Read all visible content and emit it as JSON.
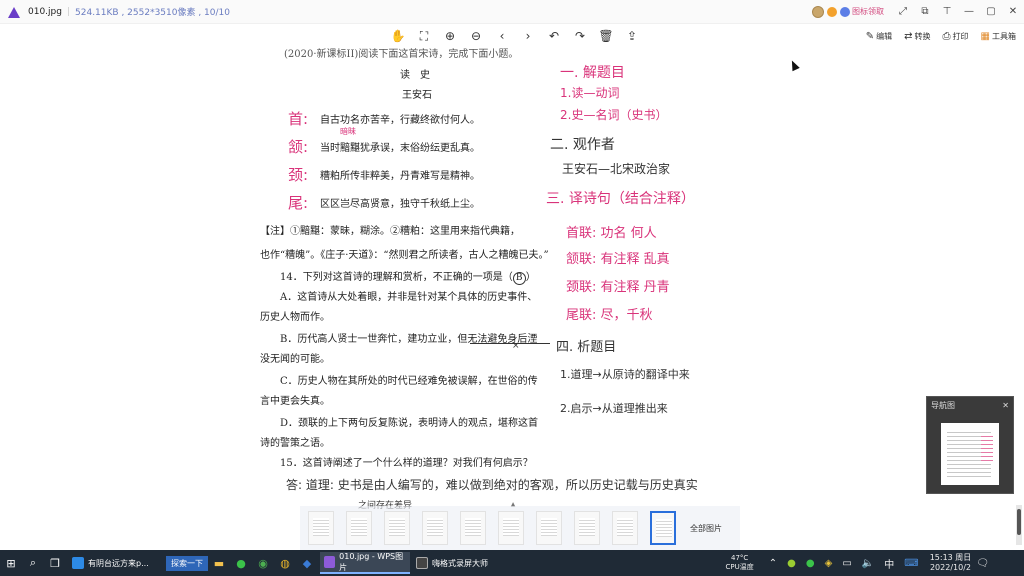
{
  "titlebar": {
    "filename": "010.jpg",
    "fileinfo": "524.11KB , 2552*3510像素 , 10/10",
    "vip_label": "图标领取"
  },
  "toolbar": {
    "right_buttons": [
      "编辑",
      "转换",
      "打印",
      "工具箱"
    ]
  },
  "doc": {
    "intro": "(2020·新课标II)阅读下面这首宋诗，完成下面小题。",
    "title": "读　史",
    "author": "王安石",
    "poem": [
      "自古功名亦苦辛，行藏终欲付何人。",
      "当时黯黮犹承误，末俗纷纭更乱真。",
      "糟粕所传非粹美，丹青难写是精神。",
      "区区岂尽高贤意，独守千秋纸上尘。"
    ],
    "note1": "【注】①黯黮：蒙昧，糊涂。②糟粕：这里用来指代典籍，",
    "note2": "也作“糟魄”。《庄子·天道》：“然则君之所读者，古人之糟魄已夫。”",
    "q14": "14．下列对这首诗的理解和赏析，不正确的一项是（",
    "q14_answer": "B",
    "q14_close": "）",
    "optA1": "A．这首诗从大处着眼，并非是针对某个具体的历史事件、",
    "optA2": "历史人物而作。",
    "optB1": "B．历代高人贤士一世奔忙，建功立业，但无法避免身后湮",
    "optB2": "没无闻的可能。",
    "optC1": "C．历史人物在其所处的时代已经难免被误解，在世俗的传",
    "optC2": "言中更会失真。",
    "optD1": "D．颈联的上下两句反复陈说，表明诗人的观点，堪称这首",
    "optD2": "诗的警策之语。",
    "q15": "15．这首诗阐述了一个什么样的道理？对我们有何启示？",
    "hw_left": [
      "首:",
      "颔:",
      "颈:",
      "尾:"
    ],
    "hw_above": "暗昧",
    "hw_x": "×",
    "hw_right": [
      "一. 解题目",
      "1.读—动词",
      "2.史—名词（史书）",
      "二. 观作者",
      "王安石—北宋政治家",
      "三. 译诗句（结合注释）",
      "首联: 功名  何人",
      "颔联: 有注释   乱真",
      "颈联: 有注释   丹青",
      "尾联: 尽，千秋",
      "四. 析题目",
      "1.道理→从原诗的翻译中来",
      "2.启示→从道理推出来"
    ],
    "hw_answer": "答: 道理: 史书是由人编写的，难以做到绝对的客观，所以历史记载与历史真实",
    "hw_answer2": "之间存在差异"
  },
  "strip": {
    "all_label": "全部图片"
  },
  "nav": {
    "title": "导航图"
  },
  "taskbar": {
    "search_label": "探索一下",
    "edge_label": "有阴台远方来p...",
    "wps_label": "010.jpg - WPS图片",
    "rec_label": "嗨格式录屏大师",
    "weather_temp": "47°C",
    "weather_label": "CPU温度",
    "time": "15:13 周日",
    "date": "2022/10/2",
    "ime": "中"
  },
  "colors": {
    "handwriting": "#d9337a",
    "taskbar": "#1f2a36",
    "accent": "#2a6fdb"
  }
}
